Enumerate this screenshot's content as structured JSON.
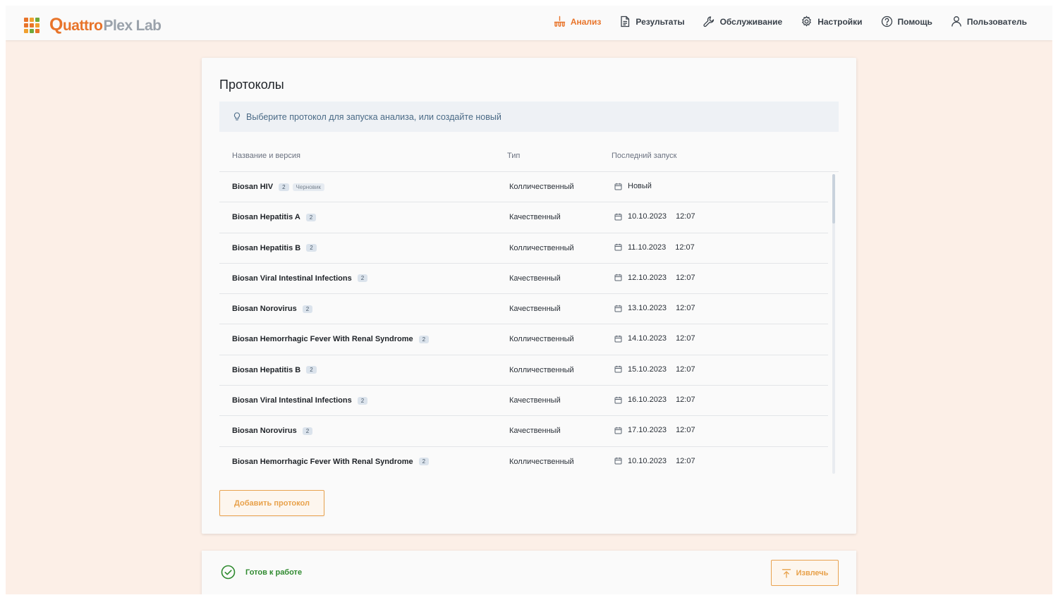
{
  "brand": {
    "logo_q": "Q",
    "logo_a": "uattro",
    "logo_b": "Plex",
    "logo_c": "Lab",
    "grid_colors": [
      "#e8742a",
      "#f0a030",
      "#6fa83a",
      "#e8742a",
      "#e8742a",
      "#f0a030",
      "#f0a030",
      "#6fa83a",
      "#e8742a"
    ]
  },
  "nav": {
    "items": [
      {
        "label": "Анализ",
        "icon": "analysis-icon",
        "active": true
      },
      {
        "label": "Результаты",
        "icon": "document-icon"
      },
      {
        "label": "Обслуживание",
        "icon": "wrench-icon"
      },
      {
        "label": "Настройки",
        "icon": "gear-icon"
      },
      {
        "label": "Помощь",
        "icon": "help-icon"
      },
      {
        "label": "Пользователь",
        "icon": "user-icon"
      }
    ]
  },
  "protocols": {
    "title": "Протоколы",
    "hint": "Выберите протокол для запуска анализа, или создайте новый",
    "columns": {
      "name": "Название и версия",
      "type": "Тип",
      "last_run": "Последний запуск"
    },
    "rows": [
      {
        "name": "Biosan HIV",
        "version": "2",
        "draft": "Черновик",
        "type": "Колличественный",
        "date": "Новый",
        "time": ""
      },
      {
        "name": "Biosan Hepatitis A",
        "version": "2",
        "type": "Качественный",
        "date": "10.10.2023",
        "time": "12:07"
      },
      {
        "name": "Biosan Hepatitis B",
        "version": "2",
        "type": "Колличественный",
        "date": "11.10.2023",
        "time": "12:07"
      },
      {
        "name": "Biosan Viral Intestinal Infections",
        "version": "2",
        "type": "Качественный",
        "date": "12.10.2023",
        "time": "12:07"
      },
      {
        "name": "Biosan Norovirus",
        "version": "2",
        "type": "Качественный",
        "date": "13.10.2023",
        "time": "12:07"
      },
      {
        "name": "Biosan Hemorrhagic Fever With Renal Syndrome",
        "version": "2",
        "type": "Колличественный",
        "date": "14.10.2023",
        "time": "12:07"
      },
      {
        "name": "Biosan Hepatitis B",
        "version": "2",
        "type": "Колличественный",
        "date": "15.10.2023",
        "time": "12:07"
      },
      {
        "name": "Biosan Viral Intestinal Infections",
        "version": "2",
        "type": "Качественный",
        "date": "16.10.2023",
        "time": "12:07"
      },
      {
        "name": "Biosan Norovirus",
        "version": "2",
        "type": "Качественный",
        "date": "17.10.2023",
        "time": "12:07"
      },
      {
        "name": "Biosan Hemorrhagic Fever With Renal Syndrome",
        "version": "2",
        "type": "Колличественный",
        "date": "10.10.2023",
        "time": "12:07"
      }
    ],
    "add_button": "Добавить протокол"
  },
  "footer": {
    "status": "Готов к работе",
    "eject_button": "Извлечь"
  },
  "colors": {
    "accent": "#e8742a",
    "button_accent": "#e9a24f",
    "background": "#fcefe7",
    "status_ok": "#2f8a2f",
    "hint_text": "#4a6a86"
  }
}
